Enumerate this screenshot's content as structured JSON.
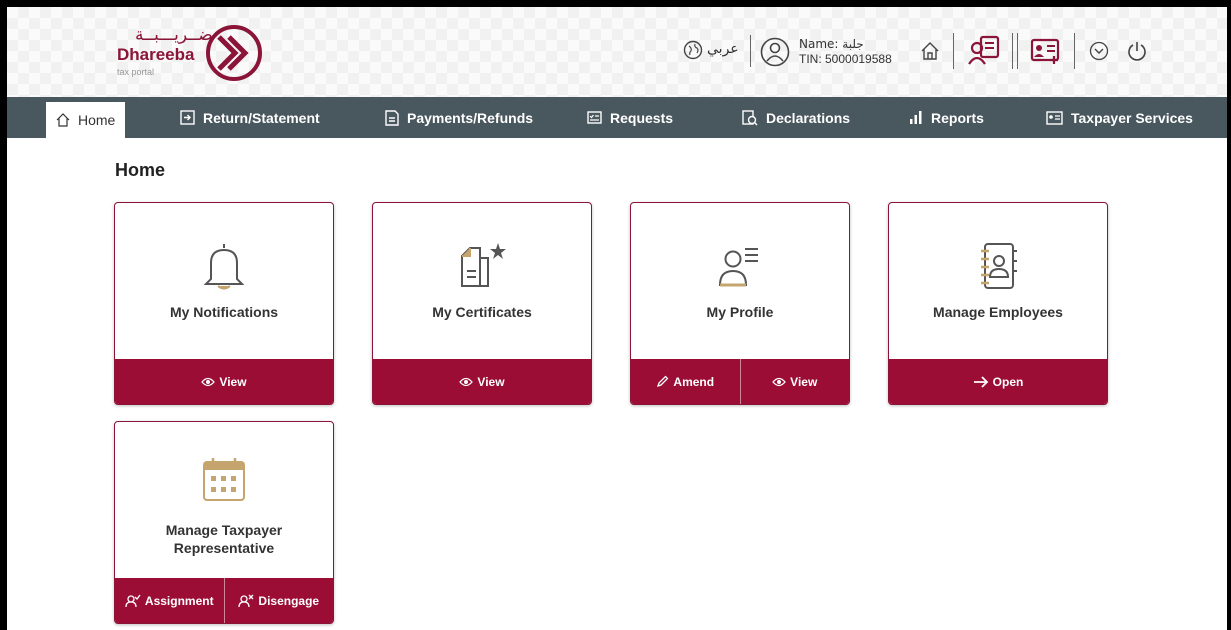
{
  "logo": {
    "arabic": "ضــريـــبــة",
    "name": "Dhareeba",
    "sub": "tax portal"
  },
  "header": {
    "lang": "عربي",
    "name_line": "Name: جلبة",
    "tin_line": "TIN: 5000019588"
  },
  "nav": {
    "home": "Home",
    "return": "Return/Statement",
    "payments": "Payments/Refunds",
    "requests": "Requests",
    "declarations": "Declarations",
    "reports": "Reports",
    "taxpayer": "Taxpayer Services"
  },
  "page_title": "Home",
  "cards": {
    "notifications": {
      "title": "My Notifications",
      "btn1": "View"
    },
    "certificates": {
      "title": "My Certificates",
      "btn1": "View"
    },
    "profile": {
      "title": "My Profile",
      "btn1": "Amend",
      "btn2": "View"
    },
    "employees": {
      "title": "Manage Employees",
      "btn1": "Open"
    },
    "representative": {
      "title_line1": "Manage Taxpayer",
      "title_line2": "Representative",
      "btn1": "Assignment",
      "btn2": "Disengage"
    }
  },
  "colors": {
    "brand": "#9b0d35",
    "nav": "#49575e",
    "icon_gold": "#c5a46d"
  }
}
